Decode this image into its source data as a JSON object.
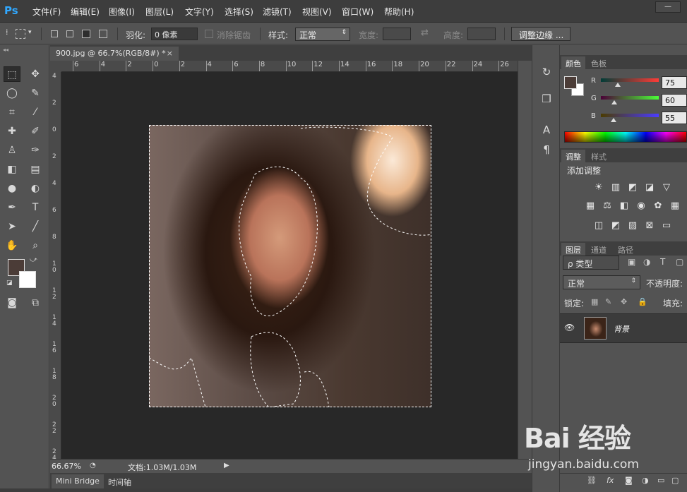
{
  "app": {
    "logo": "Ps"
  },
  "menu": [
    "文件(F)",
    "编辑(E)",
    "图像(I)",
    "图层(L)",
    "文字(Y)",
    "选择(S)",
    "滤镜(T)",
    "视图(V)",
    "窗口(W)",
    "帮助(H)"
  ],
  "window_buttons": {
    "minimize": "—",
    "restore": "▭"
  },
  "options": {
    "feather_label": "羽化:",
    "feather_value": "0 像素",
    "antialias_label": "消除锯齿",
    "style_label": "样式:",
    "style_value": "正常",
    "width_label": "宽度:",
    "height_label": "高度:",
    "refine_button": "调整边缘 ..."
  },
  "document": {
    "tab_title": "900.jpg @ 66.7%(RGB/8#) *",
    "close": "×",
    "ruler_h": [
      "6",
      "4",
      "2",
      "0",
      "2",
      "4",
      "6",
      "8",
      "10",
      "12",
      "14",
      "16",
      "18",
      "20",
      "22",
      "24",
      "26"
    ],
    "ruler_v": [
      "4",
      "2",
      "0",
      "2",
      "4",
      "6",
      "8",
      "10",
      "12",
      "14",
      "16",
      "18",
      "20",
      "22",
      "24"
    ]
  },
  "status": {
    "zoom": "66.67%",
    "doc_info": "文档:1.03M/1.03M",
    "arrow": "▶"
  },
  "bottom_tabs": [
    "Mini Bridge",
    "时间轴"
  ],
  "color_panel": {
    "tabs": [
      "颜色",
      "色板"
    ],
    "channels": [
      {
        "label": "R",
        "value": "75",
        "pos": 0.294
      },
      {
        "label": "G",
        "value": "60",
        "pos": 0.235
      },
      {
        "label": "B",
        "value": "55",
        "pos": 0.216
      }
    ],
    "colors": {
      "foreground": "#4b3c37",
      "background": "#ffffff"
    }
  },
  "adjust_panel": {
    "tabs": [
      "调整",
      "样式"
    ],
    "title": "添加调整"
  },
  "layers_panel": {
    "tabs": [
      "图层",
      "通道",
      "路径"
    ],
    "filter_label": "ρ 类型",
    "blend_mode": "正常",
    "opacity_label": "不透明度:",
    "lock_label": "锁定:",
    "fill_label": "填充:",
    "layer_name": "背景"
  },
  "watermark": {
    "brand": "Bai 经验",
    "url": "jingyan.baidu.com"
  }
}
